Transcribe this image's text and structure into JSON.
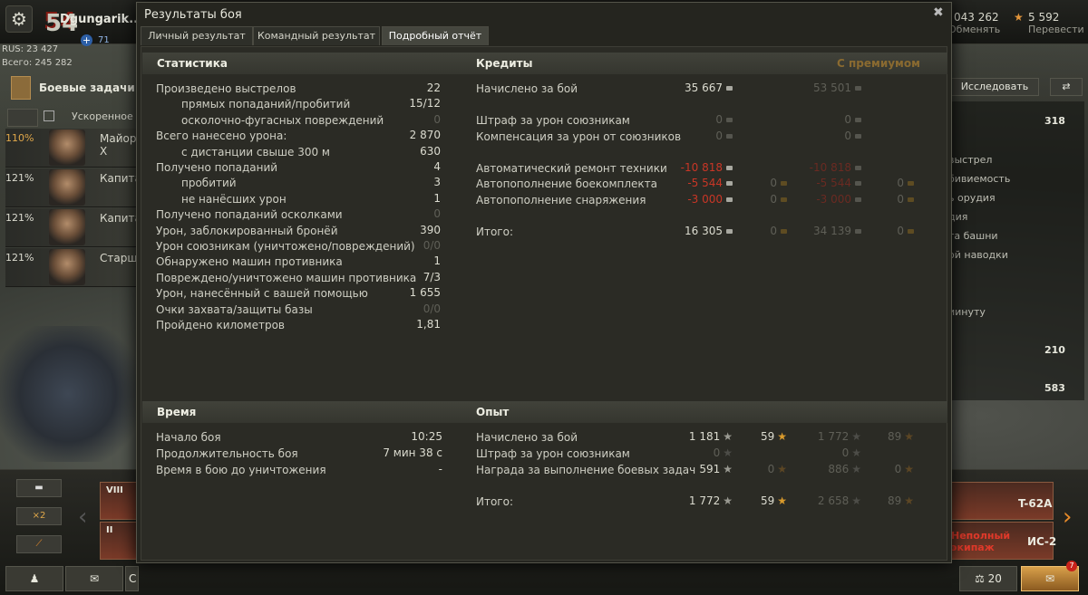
{
  "hangar": {
    "level": "54",
    "nickname": "Dgungarik..",
    "plus_count": "71",
    "rus_label": "RUS: 23 427",
    "total_label": "Всего: 245 282",
    "tasks_label": "Боевые задачи",
    "accelerated": "Ускоренное об",
    "crew": [
      {
        "pct": "110%",
        "rank": "Майор Х"
      },
      {
        "pct": "121%",
        "rank": "Капитан"
      },
      {
        "pct": "121%",
        "rank": "Капитан"
      },
      {
        "pct": "121%",
        "rank": "Старши"
      }
    ],
    "gold_value": "043 262",
    "gold_sub": "Обменять",
    "free_xp_value": "5 592",
    "free_xp_sub": "Перевести",
    "research_label": "Исследовать",
    "right_panel": {
      "num1": "318",
      "lines": [
        "выстрел",
        "бивиемость",
        "ь орудия",
        "дия",
        "та башни",
        "ой наводки",
        "",
        "иинуту"
      ],
      "num2": "210",
      "num3": "583"
    },
    "bottom": {
      "x2_label": "×2",
      "tank1_tier": "VIII",
      "tank2_tier": "II",
      "tank3_name": "T-62A",
      "tank4_name": "ИС-2",
      "incomplete_crew": "Неполный экипаж",
      "chat_placeholder": "С",
      "scales_count": "20",
      "notif_count": "7"
    }
  },
  "dialog": {
    "title": "Результаты боя",
    "tabs": [
      "Личный результат",
      "Командный результат",
      "Подробный отчёт"
    ],
    "active_tab": 2,
    "stats": {
      "header": "Статистика",
      "rows": [
        {
          "label": "Произведено выстрелов",
          "value": "22",
          "indent": false,
          "dim": false
        },
        {
          "label": "прямых попаданий/пробитий",
          "value": "15/12",
          "indent": true,
          "dim": false
        },
        {
          "label": "осколочно-фугасных повреждений",
          "value": "0",
          "indent": true,
          "dim": true
        },
        {
          "label": "Всего нанесено урона:",
          "value": "2 870",
          "indent": false,
          "dim": false
        },
        {
          "label": "с дистанции свыше 300 м",
          "value": "630",
          "indent": true,
          "dim": false
        },
        {
          "label": "Получено попаданий",
          "value": "4",
          "indent": false,
          "dim": false
        },
        {
          "label": "пробитий",
          "value": "3",
          "indent": true,
          "dim": false
        },
        {
          "label": "не нанёсших урон",
          "value": "1",
          "indent": true,
          "dim": false
        },
        {
          "label": "Получено попаданий осколками",
          "value": "0",
          "indent": false,
          "dim": true
        },
        {
          "label": "Урон, заблокированный бронёй",
          "value": "390",
          "indent": false,
          "dim": false
        },
        {
          "label": "Урон союзникам (уничтожено/повреждений)",
          "value": "0/0",
          "indent": false,
          "dim": true
        },
        {
          "label": "Обнаружено машин противника",
          "value": "1",
          "indent": false,
          "dim": false
        },
        {
          "label": "Повреждено/уничтожено машин противника",
          "value": "7/3",
          "indent": false,
          "dim": false
        },
        {
          "label": "Урон, нанесённый с вашей помощью",
          "value": "1 655",
          "indent": false,
          "dim": false
        },
        {
          "label": "Очки захвата/защиты базы",
          "value": "0/0",
          "indent": false,
          "dim": true
        },
        {
          "label": "Пройдено километров",
          "value": "1,81",
          "indent": false,
          "dim": false
        }
      ]
    },
    "credits": {
      "header": "Кредиты",
      "premium_header": "С премиумом",
      "rows": [
        {
          "label": "Начислено за бой",
          "c1": "35 667",
          "g1": "",
          "c2": "53 501",
          "g2": "",
          "red": false,
          "dim1": false
        },
        {
          "label": "Штраф за урон союзникам",
          "c1": "0",
          "g1": "",
          "c2": "0",
          "g2": "",
          "red": false,
          "dim1": true
        },
        {
          "label": "Компенсация за урон от союзников",
          "c1": "0",
          "g1": "",
          "c2": "0",
          "g2": "",
          "red": false,
          "dim1": true
        },
        {
          "label": "Автоматический ремонт техники",
          "c1": "-10 818",
          "g1": "",
          "c2": "-10 818",
          "g2": "",
          "red": true,
          "dim1": false
        },
        {
          "label": "Автопополнение боекомплекта",
          "c1": "-5 544",
          "g1": "0",
          "c2": "-5 544",
          "g2": "0",
          "red": true,
          "dim1": false
        },
        {
          "label": "Автопополнение снаряжения",
          "c1": "-3 000",
          "g1": "0",
          "c2": "-3 000",
          "g2": "0",
          "red": true,
          "dim1": false
        },
        {
          "label": "Итого:",
          "c1": "16 305",
          "g1": "0",
          "c2": "34 139",
          "g2": "0",
          "red": false,
          "dim1": false
        }
      ]
    },
    "time": {
      "header": "Время",
      "rows": [
        {
          "label": "Начало боя",
          "value": "10:25"
        },
        {
          "label": "Продолжительность боя",
          "value": "7 мин 38 с"
        },
        {
          "label": "Время в бою до уничтожения",
          "value": "-"
        }
      ]
    },
    "xp": {
      "header": "Опыт",
      "rows": [
        {
          "label": "Начислено за бой",
          "x1": "1 181",
          "f1": "59",
          "x2": "1 772",
          "f2": "89",
          "dim1": false,
          "dimf1": false
        },
        {
          "label": "Штраф за урон союзникам",
          "x1": "0",
          "f1": "",
          "x2": "0",
          "f2": "",
          "dim1": true,
          "dimf1": true
        },
        {
          "label": "Награда за выполнение боевых задач",
          "x1": "591",
          "f1": "0",
          "x2": "886",
          "f2": "0",
          "dim1": false,
          "dimf1": true
        },
        {
          "label": "Итого:",
          "x1": "1 772",
          "f1": "59",
          "x2": "2 658",
          "f2": "89",
          "dim1": false,
          "dimf1": false
        }
      ]
    }
  }
}
